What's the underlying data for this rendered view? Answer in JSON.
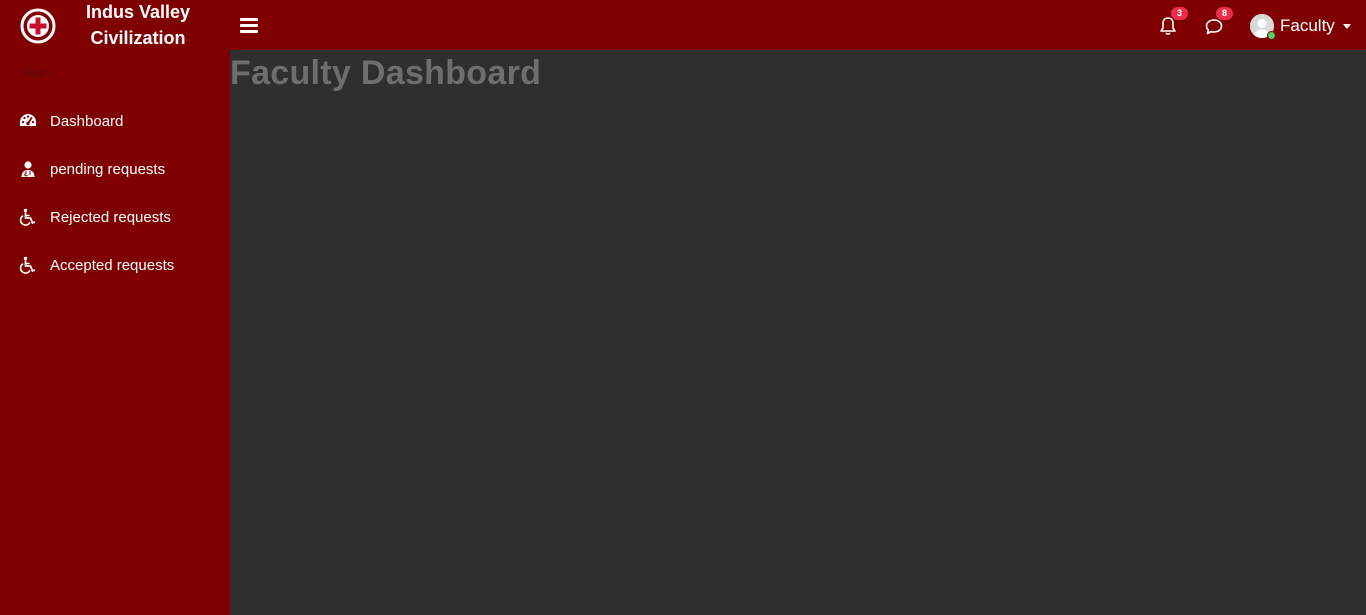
{
  "brand": {
    "line1": "Indus Valley",
    "line2": "Civilization",
    "logo_icon": "medical-cross-icon"
  },
  "header": {
    "menu_icon": "hamburger-icon",
    "notifications": {
      "icon": "bell-icon",
      "count": "3"
    },
    "messages": {
      "icon": "chat-bubble-icon",
      "count": "8"
    },
    "user": {
      "name": "Faculty",
      "status": "online"
    }
  },
  "sidebar": {
    "section_title": "Main",
    "items": [
      {
        "label": "Dashboard",
        "icon": "dashboard-gauge-icon"
      },
      {
        "label": "pending requests",
        "icon": "user-doctor-icon"
      },
      {
        "label": "Rejected requests",
        "icon": "wheelchair-icon"
      },
      {
        "label": "Accepted requests",
        "icon": "wheelchair-icon"
      }
    ]
  },
  "main": {
    "page_title": "Faculty Dashboard"
  },
  "colors": {
    "brand": "#7f0000",
    "content_bg": "#2f2f2f",
    "badge": "#e8304a",
    "online": "#55ce63",
    "page_title": "#6e6e6e"
  }
}
